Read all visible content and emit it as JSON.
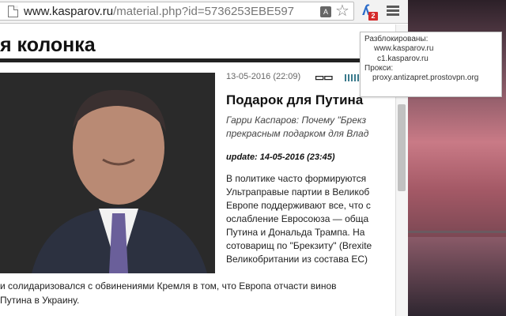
{
  "browser": {
    "url_host": "www.kasparov.ru",
    "url_path": "/material.php?id=5736253EBE597",
    "translate_icon": "translate-icon",
    "star_icon": "star-icon",
    "extension_badge": "2",
    "menu_icon": "menu-icon"
  },
  "popup": {
    "unblocked_label": "Разблокированы:",
    "unblocked_sites": [
      "www.kasparov.ru",
      "c1.kasparov.ru"
    ],
    "proxy_label": "Прокси:",
    "proxy_host": "proxy.antizapret.prostovpn.org"
  },
  "page": {
    "title": "я колонка"
  },
  "article": {
    "date": "13-05-2016 (22:09)",
    "headline": "Подарок для Путина",
    "subtitle_lines": [
      "Гарри Каспаров: Почему \"Брекз",
      "прекрасным подарком для Влад"
    ],
    "update": "update: 14-05-2016 (23:45)",
    "body_lines": [
      "В политике часто формируются",
      "Ультраправые партии в Великоб",
      "Европе поддерживают все, что с",
      "ослабление Евросоюза — обща",
      "Путина и Дональда Трампа. На",
      "сотоварищ по \"Брекзиту\" (Brexite",
      "Великобритании из состава ЕС)"
    ],
    "bottom_lines": [
      "и солидаризовался с обвинениями Кремля в том, что Европа отчасти винов",
      " Путина в Украину."
    ]
  }
}
